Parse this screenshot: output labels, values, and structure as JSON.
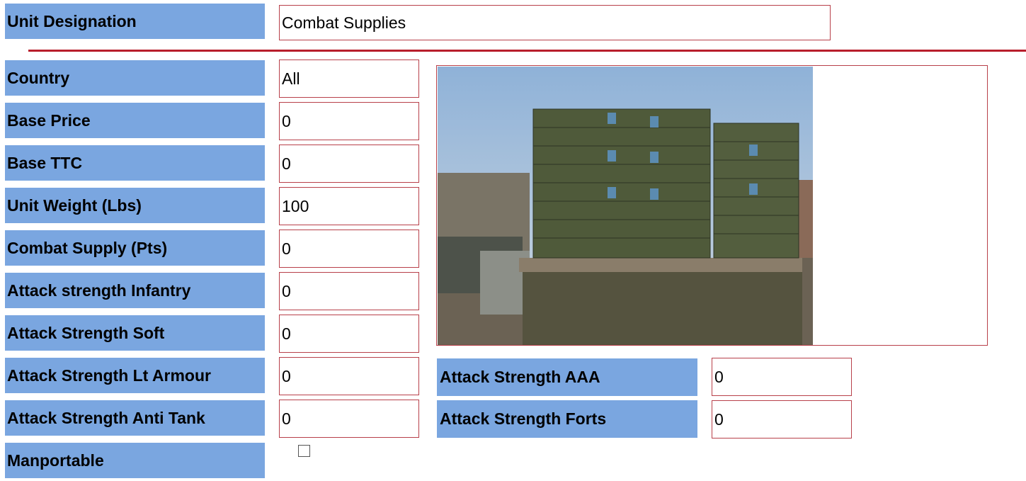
{
  "unit": {
    "designation_label": "Unit Designation",
    "designation_value": "Combat Supplies"
  },
  "fields": [
    {
      "label": "Country",
      "value": "All"
    },
    {
      "label": "Base Price",
      "value": "0"
    },
    {
      "label": "Base TTC",
      "value": "0"
    },
    {
      "label": "Unit Weight (Lbs)",
      "value": "100"
    },
    {
      "label": "Combat Supply (Pts)",
      "value": "0"
    },
    {
      "label": "Attack strength Infantry",
      "value": "0"
    },
    {
      "label": "Attack Strength Soft",
      "value": "0"
    },
    {
      "label": "Attack Strength Lt Armour",
      "value": "0"
    },
    {
      "label": "Attack Strength Anti Tank",
      "value": "0"
    }
  ],
  "extra_fields": [
    {
      "label": "Attack Strength AAA",
      "value": "0"
    },
    {
      "label": "Attack Strength Forts",
      "value": "0"
    }
  ],
  "manportable": {
    "label": "Manportable",
    "checked": false
  },
  "colors": {
    "label_bg": "#7aa6e0",
    "field_border": "#b8404a",
    "divider": "#b81e2c"
  }
}
